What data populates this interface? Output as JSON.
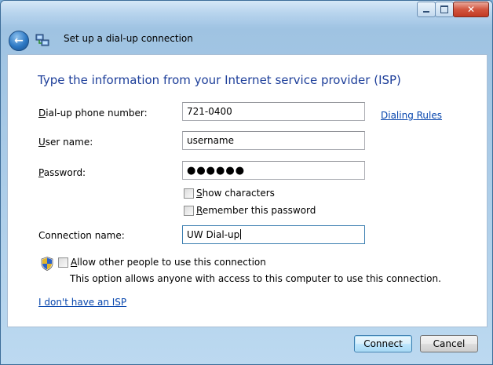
{
  "window": {
    "background_text": "                 ",
    "title": "Set up a dial-up connection",
    "controls": {
      "minimize": "",
      "maximize": "",
      "close": "✕"
    }
  },
  "nav": {
    "back_glyph": "←"
  },
  "page": {
    "heading": "Type the information from your Internet service provider (ISP)",
    "fields": {
      "phone": {
        "label": "Dial-up phone number:",
        "access_key": "D",
        "label_rest": "ial-up phone number:",
        "value": "721-0400"
      },
      "username": {
        "label": "User name:",
        "access_key": "U",
        "label_rest": "ser name:",
        "value": "username"
      },
      "password": {
        "label": "Password:",
        "access_key": "P",
        "label_rest": "assword:",
        "value": "●●●●●●"
      },
      "connection_name": {
        "label": "Connection name:",
        "value": "UW Dial-up"
      }
    },
    "dialing_rules_link": "Dialing Rules",
    "show_characters": {
      "label_key": "S",
      "label_rest": "how characters",
      "checked": false
    },
    "remember_password": {
      "label_key": "R",
      "label_rest": "emember this password",
      "checked": false
    },
    "allow_others": {
      "label_key": "A",
      "label_rest": "llow other people to use this connection",
      "checked": false,
      "description": "This option allows anyone with access to this computer to use this connection."
    },
    "no_isp_link": "I don't have an ISP"
  },
  "buttons": {
    "connect": "Connect",
    "cancel": "Cancel"
  },
  "colors": {
    "heading": "#1e3f9a",
    "link": "#0645ad",
    "accent": "#3c7fb1"
  }
}
